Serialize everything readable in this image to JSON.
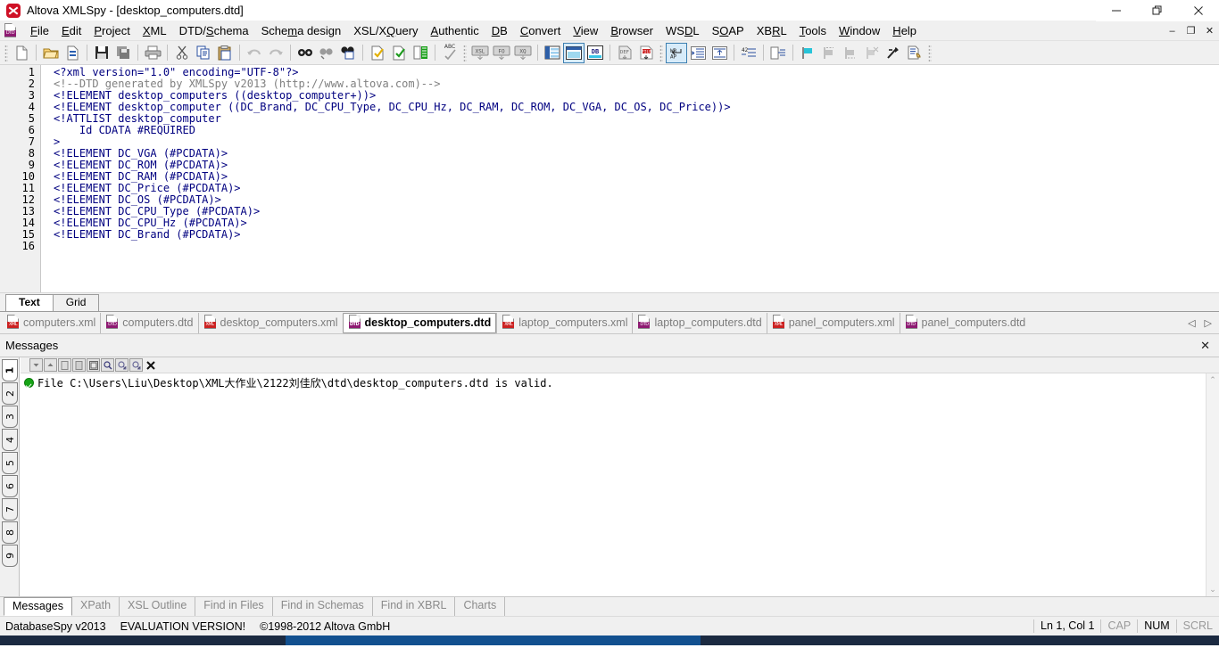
{
  "window": {
    "title": "Altova XMLSpy - [desktop_computers.dtd]",
    "app_icon": "altova-bug-icon",
    "minimize": "–",
    "maximize": "❐",
    "close": "✕"
  },
  "menubar": {
    "app_icon": "dtd-document-icon",
    "items": [
      {
        "label": "File"
      },
      {
        "label": "Edit"
      },
      {
        "label": "Project"
      },
      {
        "label": "XML"
      },
      {
        "label": "DTD/Schema"
      },
      {
        "label": "Schema design"
      },
      {
        "label": "XSL/XQuery"
      },
      {
        "label": "Authentic"
      },
      {
        "label": "DB"
      },
      {
        "label": "Convert"
      },
      {
        "label": "View"
      },
      {
        "label": "Browser"
      },
      {
        "label": "WSDL"
      },
      {
        "label": "SOAP"
      },
      {
        "label": "XBRL"
      },
      {
        "label": "Tools"
      },
      {
        "label": "Window"
      },
      {
        "label": "Help"
      }
    ],
    "mdi": {
      "minimize": "–",
      "restore": "❐",
      "close": "✕"
    }
  },
  "toolbar": {
    "buttons": [
      {
        "name": "new-file",
        "tip": "New"
      },
      {
        "name": "open-file",
        "tip": "Open"
      },
      {
        "name": "reload-file",
        "tip": "Reload"
      },
      {
        "name": "save-file",
        "tip": "Save"
      },
      {
        "name": "save-all",
        "tip": "Save All"
      },
      {
        "name": "print",
        "tip": "Print"
      },
      {
        "name": "cut",
        "tip": "Cut"
      },
      {
        "name": "copy",
        "tip": "Copy"
      },
      {
        "name": "paste",
        "tip": "Paste"
      },
      {
        "name": "undo",
        "tip": "Undo"
      },
      {
        "name": "redo",
        "tip": "Redo"
      },
      {
        "name": "find",
        "tip": "Find"
      },
      {
        "name": "find-next",
        "tip": "Find Next"
      },
      {
        "name": "find-in-files",
        "tip": "Find in Files"
      },
      {
        "name": "check-well-formed",
        "tip": "Check well-formedness"
      },
      {
        "name": "validate",
        "tip": "Validate"
      },
      {
        "name": "assign-dtd",
        "tip": "Assign DTD"
      },
      {
        "name": "spell-check",
        "tip": "Spelling"
      },
      {
        "name": "xsl-transform",
        "tip": "XSL Transformation"
      },
      {
        "name": "fo-transform",
        "tip": "XSL:FO Transformation"
      },
      {
        "name": "xquery-execute",
        "tip": "XQuery Execution"
      },
      {
        "name": "grid-view",
        "tip": "Grid View"
      },
      {
        "name": "text-view",
        "tip": "Text View",
        "selected": true
      },
      {
        "name": "database-view",
        "tip": "Database View"
      },
      {
        "name": "schema-def",
        "tip": "DEF"
      },
      {
        "name": "file-def",
        "tip": "FILE"
      },
      {
        "name": "word-wrap",
        "tip": "Word Wrap",
        "selected": true
      },
      {
        "name": "indent-increase",
        "tip": "Insert Indent"
      },
      {
        "name": "indent-decrease",
        "tip": "Remove Indent"
      },
      {
        "name": "line-numbers",
        "tip": "Line Numbers"
      },
      {
        "name": "pretty-print",
        "tip": "Pretty Print"
      },
      {
        "name": "bookmark-toggle",
        "tip": "Insert/Remove Bookmark"
      },
      {
        "name": "bookmark-prev",
        "tip": "Previous Bookmark"
      },
      {
        "name": "bookmark-next",
        "tip": "Next Bookmark"
      },
      {
        "name": "bookmark-clear",
        "tip": "Remove All Bookmarks"
      },
      {
        "name": "comment-toggle",
        "tip": "Comment/Uncomment"
      },
      {
        "name": "entity-define",
        "tip": "Define Entities"
      }
    ]
  },
  "editor": {
    "line_numbers": [
      "1",
      "2",
      "3",
      "4",
      "5",
      "6",
      "7",
      "8",
      "9",
      "10",
      "11",
      "12",
      "13",
      "14",
      "15",
      "16"
    ],
    "lines": [
      {
        "n": 1,
        "text": "<?xml version=\"1.0\" encoding=\"UTF-8\"?>",
        "style": "kw"
      },
      {
        "n": 2,
        "text": "<!--DTD generated by XMLSpy v2013 (http://www.altova.com)-->",
        "style": "cmt"
      },
      {
        "n": 3,
        "text": "<!ELEMENT desktop_computers ((desktop_computer+))>",
        "style": "kw"
      },
      {
        "n": 4,
        "text": "<!ELEMENT desktop_computer ((DC_Brand, DC_CPU_Type, DC_CPU_Hz, DC_RAM, DC_ROM, DC_VGA, DC_OS, DC_Price))>",
        "style": "kw"
      },
      {
        "n": 5,
        "text": "<!ATTLIST desktop_computer",
        "style": "kw"
      },
      {
        "n": 6,
        "text": "    Id CDATA #REQUIRED",
        "style": "kw"
      },
      {
        "n": 7,
        "text": ">",
        "style": "kw"
      },
      {
        "n": 8,
        "text": "<!ELEMENT DC_VGA (#PCDATA)>",
        "style": "kw"
      },
      {
        "n": 9,
        "text": "<!ELEMENT DC_ROM (#PCDATA)>",
        "style": "kw"
      },
      {
        "n": 10,
        "text": "<!ELEMENT DC_RAM (#PCDATA)>",
        "style": "kw"
      },
      {
        "n": 11,
        "text": "<!ELEMENT DC_Price (#PCDATA)>",
        "style": "kw"
      },
      {
        "n": 12,
        "text": "<!ELEMENT DC_OS (#PCDATA)>",
        "style": "kw"
      },
      {
        "n": 13,
        "text": "<!ELEMENT DC_CPU_Type (#PCDATA)>",
        "style": "kw"
      },
      {
        "n": 14,
        "text": "<!ELEMENT DC_CPU_Hz (#PCDATA)>",
        "style": "kw"
      },
      {
        "n": 15,
        "text": "<!ELEMENT DC_Brand (#PCDATA)>",
        "style": "kw"
      },
      {
        "n": 16,
        "text": "",
        "style": "kw"
      }
    ]
  },
  "view_tabs": [
    {
      "label": "Text",
      "active": true
    },
    {
      "label": "Grid",
      "active": false
    }
  ],
  "file_tabs": [
    {
      "label": "computers.xml",
      "icon": "xml-file-icon",
      "active": false
    },
    {
      "label": "computers.dtd",
      "icon": "dtd-file-icon",
      "active": false
    },
    {
      "label": "desktop_computers.xml",
      "icon": "xml-file-icon",
      "active": false
    },
    {
      "label": "desktop_computers.dtd",
      "icon": "dtd-file-icon",
      "active": true
    },
    {
      "label": "laptop_computers.xml",
      "icon": "xml-file-icon",
      "active": false
    },
    {
      "label": "laptop_computers.dtd",
      "icon": "dtd-file-icon",
      "active": false
    },
    {
      "label": "panel_computers.xml",
      "icon": "xml-file-icon",
      "active": false
    },
    {
      "label": "panel_computers.dtd",
      "icon": "dtd-file-icon",
      "active": false
    }
  ],
  "file_tabs_nav": {
    "prev": "◁",
    "next": "▷"
  },
  "messages_panel": {
    "title": "Messages",
    "close": "✕",
    "vertical_tabs": [
      {
        "label": "1",
        "active": true
      },
      {
        "label": "2",
        "active": false
      },
      {
        "label": "3",
        "active": false
      },
      {
        "label": "4",
        "active": false
      },
      {
        "label": "5",
        "active": false
      },
      {
        "label": "6",
        "active": false
      },
      {
        "label": "7",
        "active": false
      },
      {
        "label": "8",
        "active": false
      },
      {
        "label": "9",
        "active": false
      }
    ],
    "toolbar": [
      {
        "name": "next-message-button",
        "glyph": "▼"
      },
      {
        "name": "previous-message-button",
        "glyph": "▲"
      },
      {
        "name": "copy-message-button",
        "glyph": "▯"
      },
      {
        "name": "copy-message-children-button",
        "glyph": "▯"
      },
      {
        "name": "copy-all-messages-button",
        "glyph": "▤"
      },
      {
        "name": "find-message-button",
        "glyph": "🔍"
      },
      {
        "name": "find-previous-button",
        "glyph": "🔍"
      },
      {
        "name": "find-next-button",
        "glyph": "🔍"
      },
      {
        "name": "clear-messages-button",
        "glyph": "✕"
      }
    ],
    "messages": [
      {
        "status": "valid",
        "status_icon": "success-check-icon",
        "text": "File C:\\Users\\Liu\\Desktop\\XML大作业\\2122刘佳欣\\dtd\\desktop_computers.dtd is valid."
      }
    ],
    "scroll_up": "⌃",
    "scroll_down": "⌄"
  },
  "bottom_tabs": [
    {
      "label": "Messages",
      "active": true
    },
    {
      "label": "XPath",
      "active": false
    },
    {
      "label": "XSL Outline",
      "active": false
    },
    {
      "label": "Find in Files",
      "active": false
    },
    {
      "label": "Find in Schemas",
      "active": false
    },
    {
      "label": "Find in XBRL",
      "active": false
    },
    {
      "label": "Charts",
      "active": false
    }
  ],
  "statusbar": {
    "product": "DatabaseSpy v2013",
    "license": "EVALUATION VERSION!",
    "copyright": "©1998-2012 Altova GmbH",
    "position": "Ln 1, Col 1",
    "caps": "CAP",
    "num": "NUM",
    "scroll": "SCRL"
  },
  "colors": {
    "chrome": "#f0f0f0",
    "editor_text": "#000080",
    "comment_text": "#808080",
    "accent_selected": "#3c7fb1",
    "valid_green": "#16a416",
    "taskbar": "#1b2a41",
    "taskbar_highlight": "#12508f"
  }
}
